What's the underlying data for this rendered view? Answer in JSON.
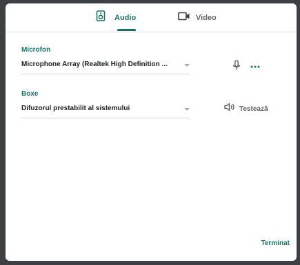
{
  "tabs": {
    "audio_label": "Audio",
    "video_label": "Video",
    "active": "audio"
  },
  "microphone": {
    "title": "Microfon",
    "selected": "Microphone Array (Realtek High Definition ...",
    "mic_icon": "microphone-icon",
    "more_icon": "more-horizontal-icon"
  },
  "speakers": {
    "title": "Boxe",
    "selected": "Difuzorul prestabilit al sistemului",
    "test_icon": "speaker-icon",
    "test_label": "Testează"
  },
  "footer": {
    "done_label": "Terminat"
  },
  "colors": {
    "accent": "#1a7363",
    "backdrop": "#3c4043",
    "muted": "#5f6368"
  }
}
